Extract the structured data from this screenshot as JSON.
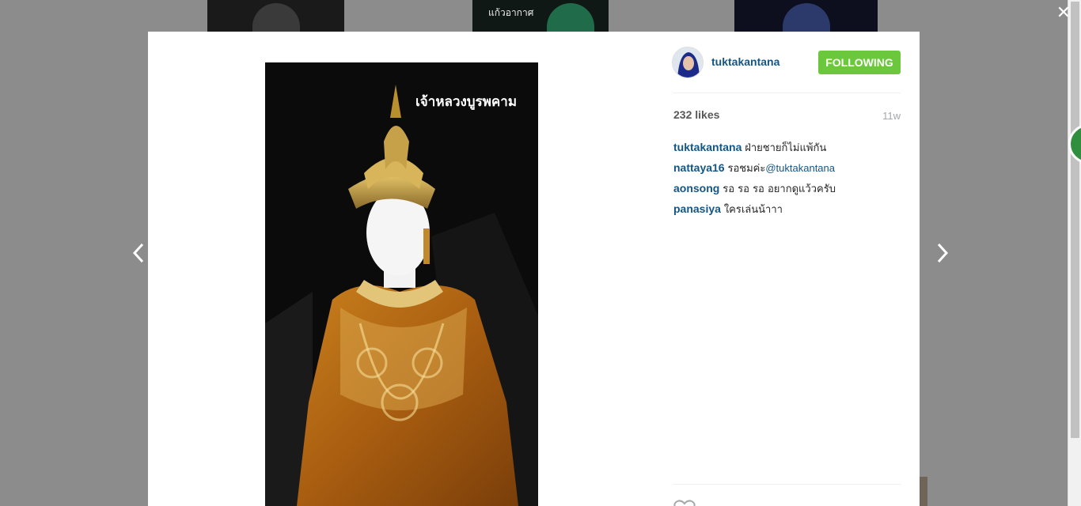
{
  "background": {
    "thumbnail_texts": [
      "แก้วอากาศ"
    ]
  },
  "overlay": {
    "close_glyph": "✕"
  },
  "post": {
    "photo_caption": "เจ้าหลวงบูรพคาม",
    "author": "tuktakantana",
    "follow_label": "FOLLOWING",
    "likes": "232 likes",
    "age": "11w",
    "comments": [
      {
        "user": "tuktakantana",
        "text": "ฝ่ายชายก็ไม่แพ้กัน",
        "mention": ""
      },
      {
        "user": "nattaya16",
        "text": "รอชมค่ะ",
        "mention": "@tuktakantana"
      },
      {
        "user": "aonsong",
        "text": "รอ รอ รอ อยากดูแว้วครับ",
        "mention": ""
      },
      {
        "user": "panasiya",
        "text": "ใครเล่นน้าาา",
        "mention": ""
      }
    ]
  },
  "icons": {
    "close": "close-icon",
    "prev": "chevron-left-icon",
    "next": "chevron-right-icon",
    "like": "heart-icon"
  },
  "colors": {
    "follow_button": "#6bc83c",
    "username": "#125688",
    "overlay": "#8c8c8c"
  }
}
